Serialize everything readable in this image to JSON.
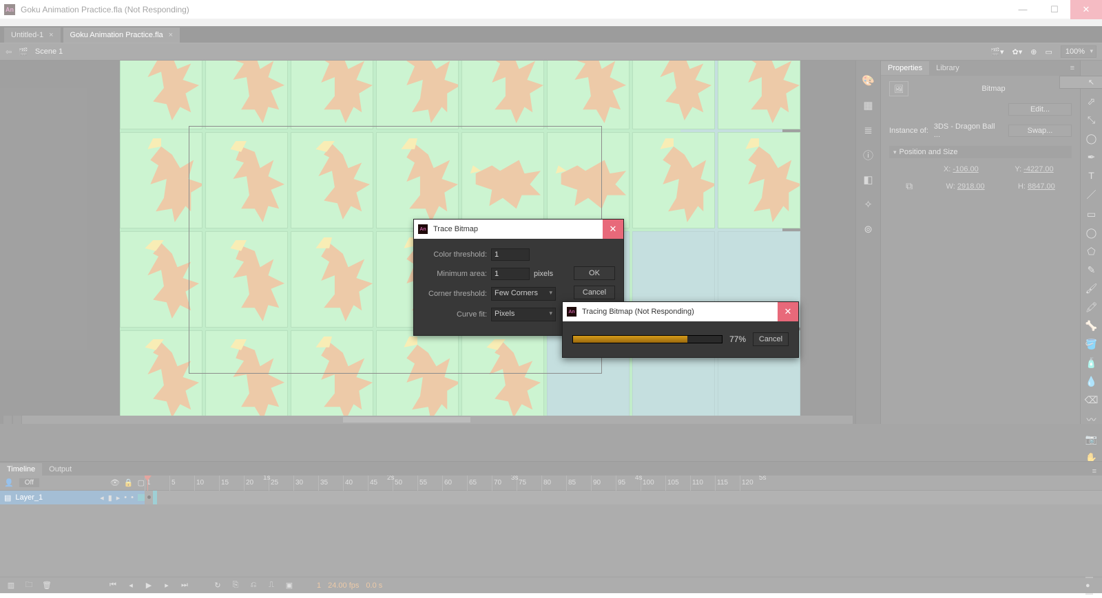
{
  "window": {
    "app_abbr": "An",
    "title": "Goku Animation Practice.fla (Not Responding)"
  },
  "doc_tabs": [
    {
      "label": "Untitled-1"
    },
    {
      "label": "Goku Animation Practice.fla"
    }
  ],
  "scene": {
    "name": "Scene 1",
    "zoom": "100%"
  },
  "panel_tabs": {
    "properties": "Properties",
    "library": "Library"
  },
  "properties": {
    "type_label": "Bitmap",
    "edit": "Edit...",
    "instance_label": "Instance of:",
    "instance_value": "3DS - Dragon Ball ...",
    "swap": "Swap...",
    "section": "Position and Size",
    "x_label": "X:",
    "x_val": "-106.00",
    "y_label": "Y:",
    "y_val": "-4227.00",
    "w_label": "W:",
    "w_val": "2918.00",
    "h_label": "H:",
    "h_val": "8847.00"
  },
  "timeline": {
    "tab_timeline": "Timeline",
    "tab_output": "Output",
    "onion_off": "Off",
    "layer1": "Layer_1",
    "seconds": [
      "1s",
      "2s",
      "3s",
      "4s",
      "5s"
    ],
    "frames": [
      "1",
      "5",
      "10",
      "15",
      "20",
      "25",
      "30",
      "35",
      "40",
      "45",
      "50",
      "55",
      "60",
      "65",
      "70",
      "75",
      "80",
      "85",
      "90",
      "95",
      "100",
      "105",
      "110",
      "115",
      "120"
    ],
    "current_frame": "1",
    "fps": "24.00 fps",
    "time": "0.0 s"
  },
  "trace_dialog": {
    "title": "Trace Bitmap",
    "color_threshold_label": "Color threshold:",
    "color_threshold_val": "1",
    "min_area_label": "Minimum area:",
    "min_area_val": "1",
    "min_area_unit": "pixels",
    "corner_label": "Corner threshold:",
    "corner_val": "Few Corners",
    "curve_label": "Curve fit:",
    "curve_val": "Pixels",
    "ok": "OK",
    "cancel": "Cancel"
  },
  "progress_dialog": {
    "title": "Tracing Bitmap (Not Responding)",
    "percent_text": "77%",
    "percent": 77,
    "cancel": "Cancel"
  }
}
